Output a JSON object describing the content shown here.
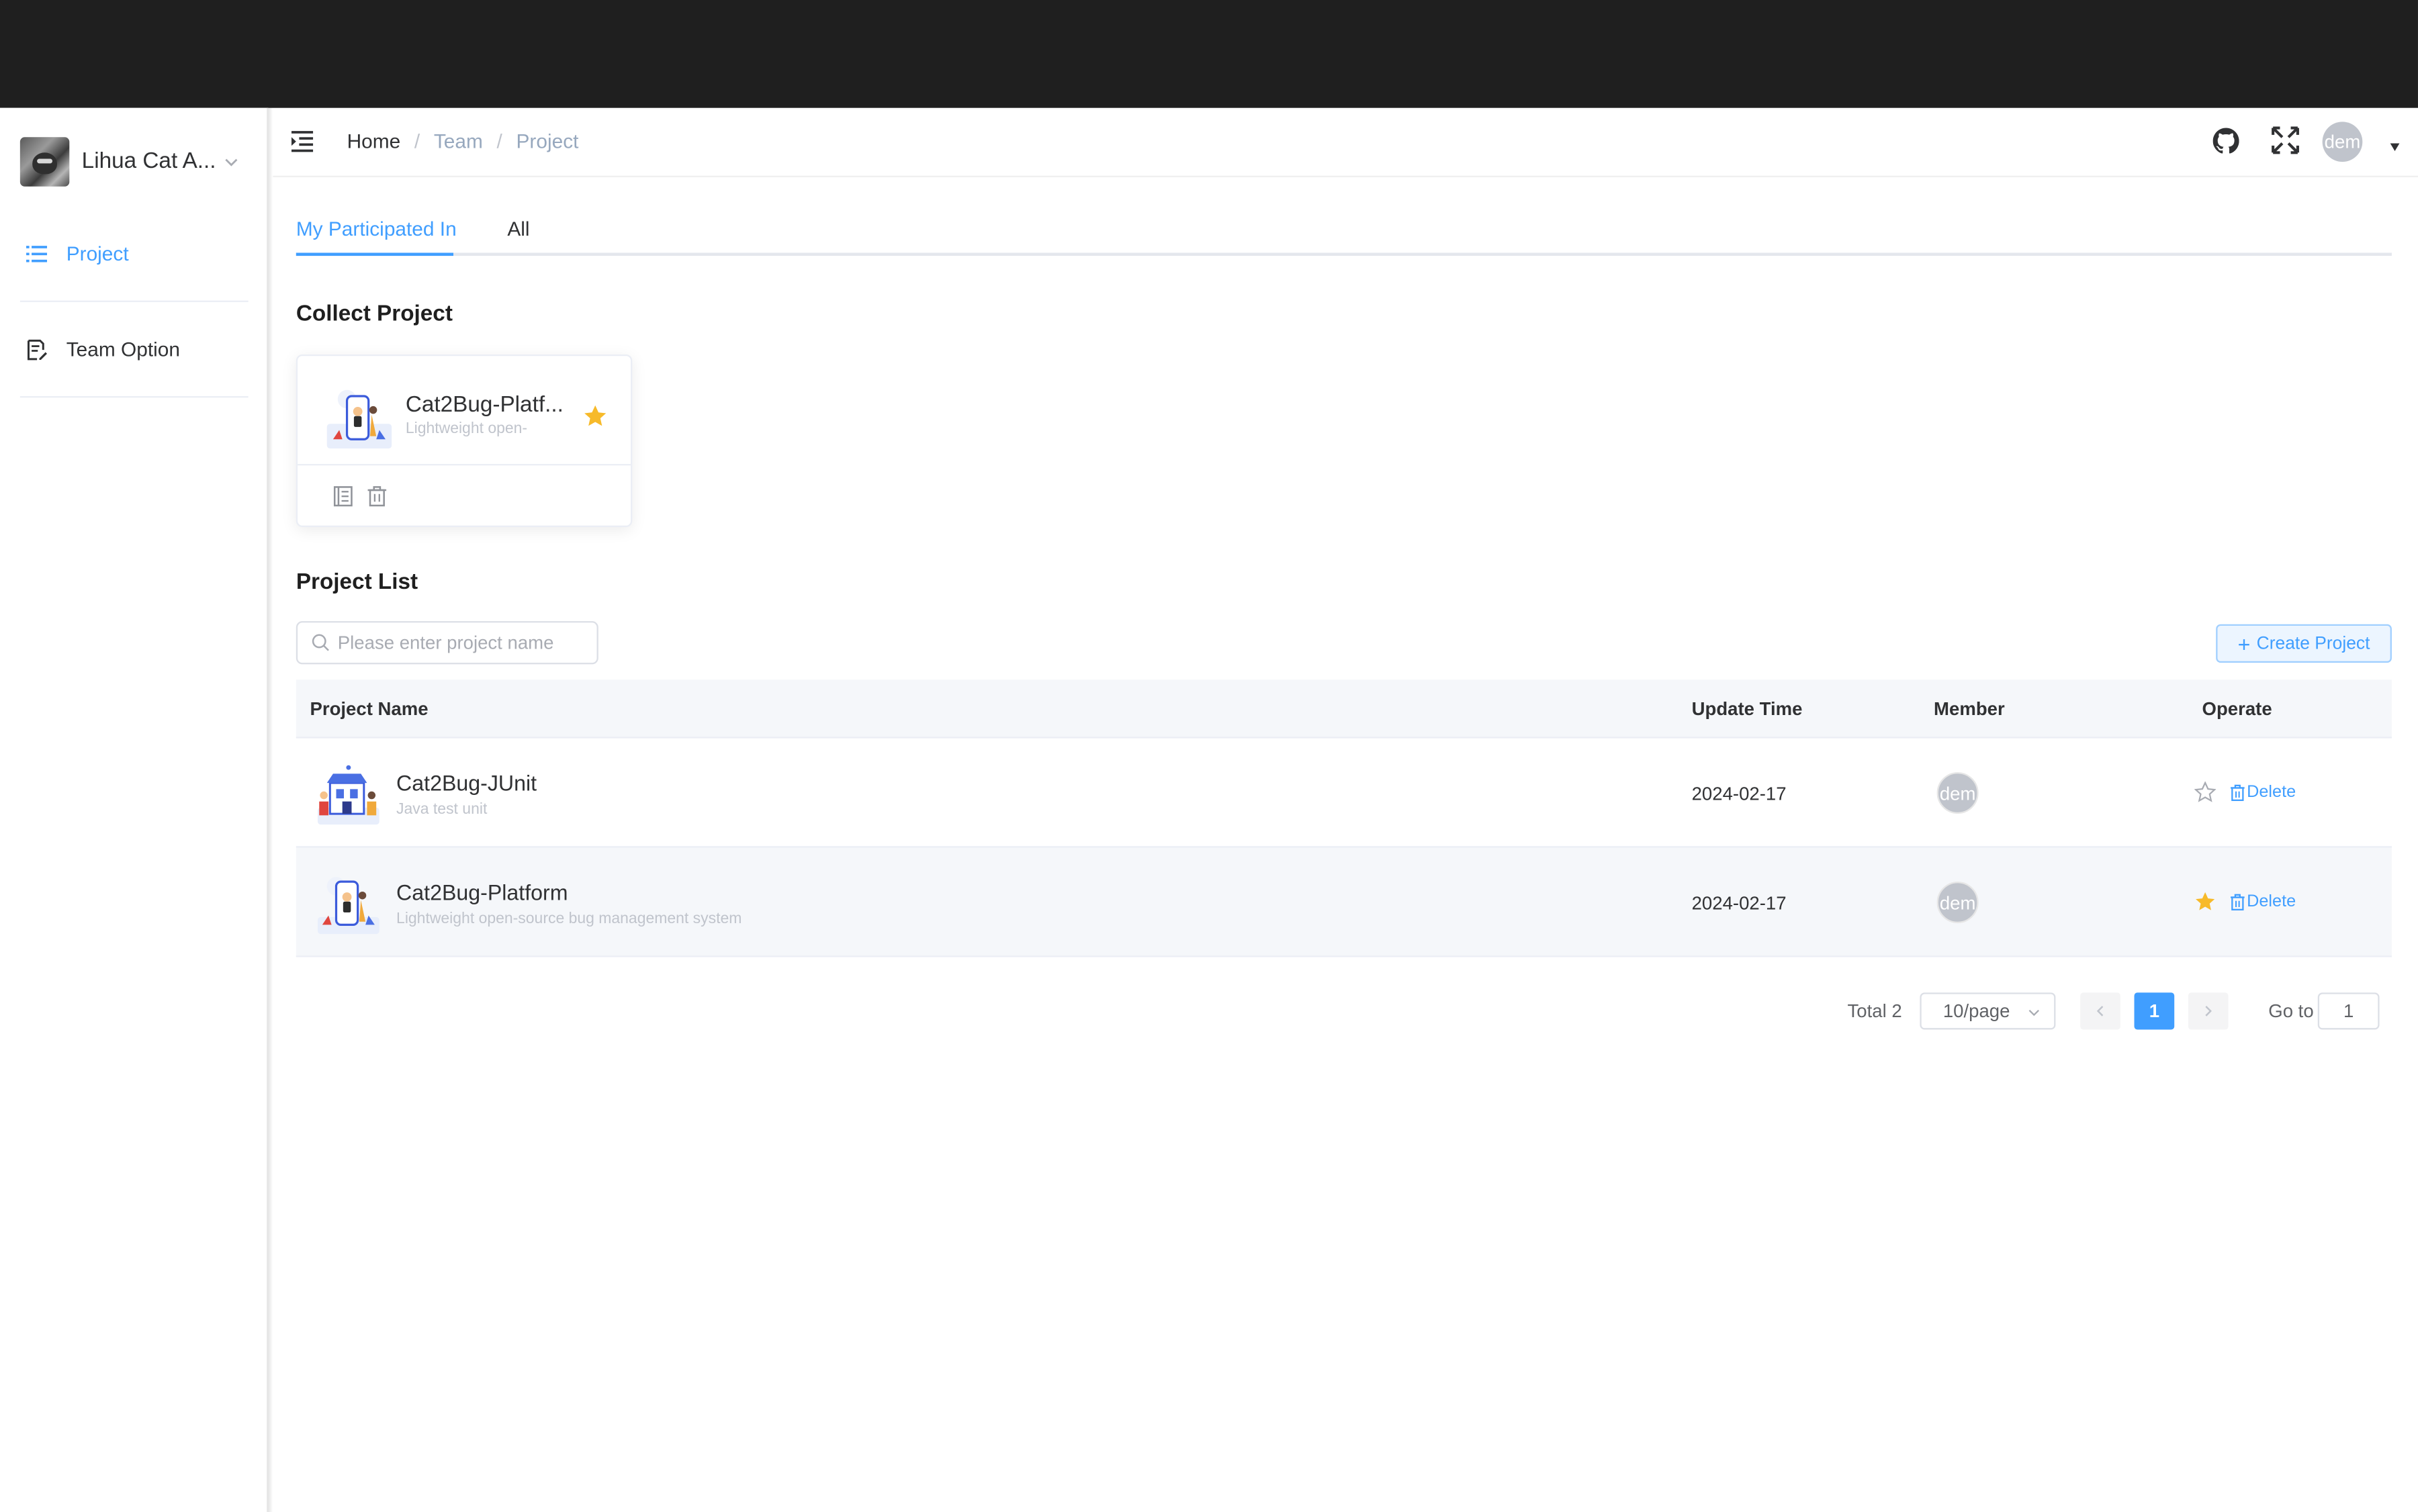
{
  "colors": {
    "accent": "#409eff",
    "topbar": "#1f1f1f",
    "star": "#f7ba2a",
    "muted_text": "#c0c4cc",
    "table_header_bg": "#f5f7fa"
  },
  "sidebar": {
    "team_name": "Lihua Cat A...",
    "items": [
      {
        "label": "Project",
        "icon": "list-icon",
        "active": true
      },
      {
        "label": "Team Option",
        "icon": "document-edit-icon",
        "active": false
      }
    ]
  },
  "header": {
    "breadcrumb": [
      "Home",
      "Team",
      "Project"
    ],
    "user_avatar_text": "dem",
    "icons": [
      "github-icon",
      "fullscreen-icon"
    ]
  },
  "tabs": [
    {
      "label": "My Participated In",
      "active": true
    },
    {
      "label": "All",
      "active": false
    }
  ],
  "collect": {
    "title": "Collect Project",
    "card": {
      "name": "Cat2Bug-Platf...",
      "description": "Lightweight open-",
      "starred": true
    }
  },
  "project_list": {
    "title": "Project List",
    "search_placeholder": "Please enter project name",
    "create_button": "Create Project",
    "columns": [
      "Project Name",
      "Update Time",
      "Member",
      "Operate"
    ],
    "rows": [
      {
        "name": "Cat2Bug-JUnit",
        "description": "Java test unit",
        "update_time": "2024-02-17",
        "member": "dem",
        "starred": false,
        "delete_label": "Delete"
      },
      {
        "name": "Cat2Bug-Platform",
        "description": "Lightweight open-source bug management system",
        "update_time": "2024-02-17",
        "member": "dem",
        "starred": true,
        "delete_label": "Delete"
      }
    ]
  },
  "pagination": {
    "total_label": "Total 2",
    "page_size": "10/page",
    "current_page": "1",
    "goto_label": "Go to",
    "goto_value": "1"
  }
}
